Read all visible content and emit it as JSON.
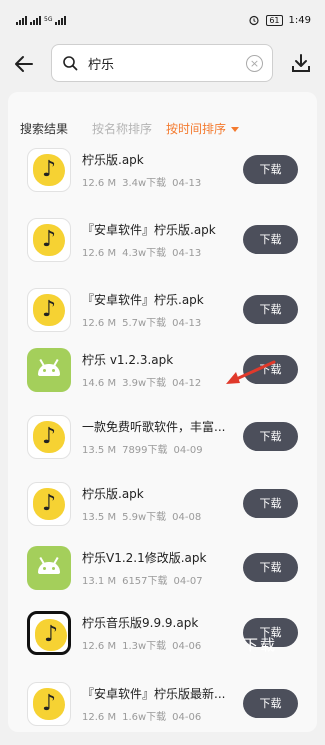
{
  "status": {
    "left": "5G",
    "battery": "61",
    "time": "1:49"
  },
  "search": {
    "query": "柠乐"
  },
  "sort": {
    "label": "搜索结果",
    "by_name": "按名称排序",
    "by_time": "按时间排序"
  },
  "download_label": "下载",
  "watermark": "下载",
  "results": [
    {
      "title": "柠乐版.apk",
      "size": "12.6 M",
      "downloads": "3.4w下载",
      "date": "04-13",
      "icon": "lemon-icon"
    },
    {
      "title": "『安卓软件』柠乐版.apk",
      "size": "12.6 M",
      "downloads": "4.3w下载",
      "date": "04-13",
      "icon": "lemon-icon"
    },
    {
      "title": "『安卓软件』柠乐.apk",
      "size": "12.6 M",
      "downloads": "5.7w下载",
      "date": "04-13",
      "icon": "lemon-icon"
    },
    {
      "title": "柠乐 v1.2.3.apk",
      "size": "14.6 M",
      "downloads": "3.9w下载",
      "date": "04-12",
      "icon": "android-icon"
    },
    {
      "title": "一款免费听歌软件，丰富...",
      "size": "13.5 M",
      "downloads": "7899下载",
      "date": "04-09",
      "icon": "lemon-icon"
    },
    {
      "title": "柠乐版.apk",
      "size": "13.5 M",
      "downloads": "5.9w下载",
      "date": "04-08",
      "icon": "lemon-icon"
    },
    {
      "title": "柠乐V1.2.1修改版.apk",
      "size": "13.1 M",
      "downloads": "6157下载",
      "date": "04-07",
      "icon": "android-icon"
    },
    {
      "title": "柠乐音乐版9.9.9.apk",
      "size": "12.6 M",
      "downloads": "1.3w下载",
      "date": "04-06",
      "icon": "lemon-framed-icon"
    },
    {
      "title": "『安卓软件』柠乐版最新...",
      "size": "12.6 M",
      "downloads": "1.6w下载",
      "date": "04-06",
      "icon": "lemon-icon"
    }
  ]
}
